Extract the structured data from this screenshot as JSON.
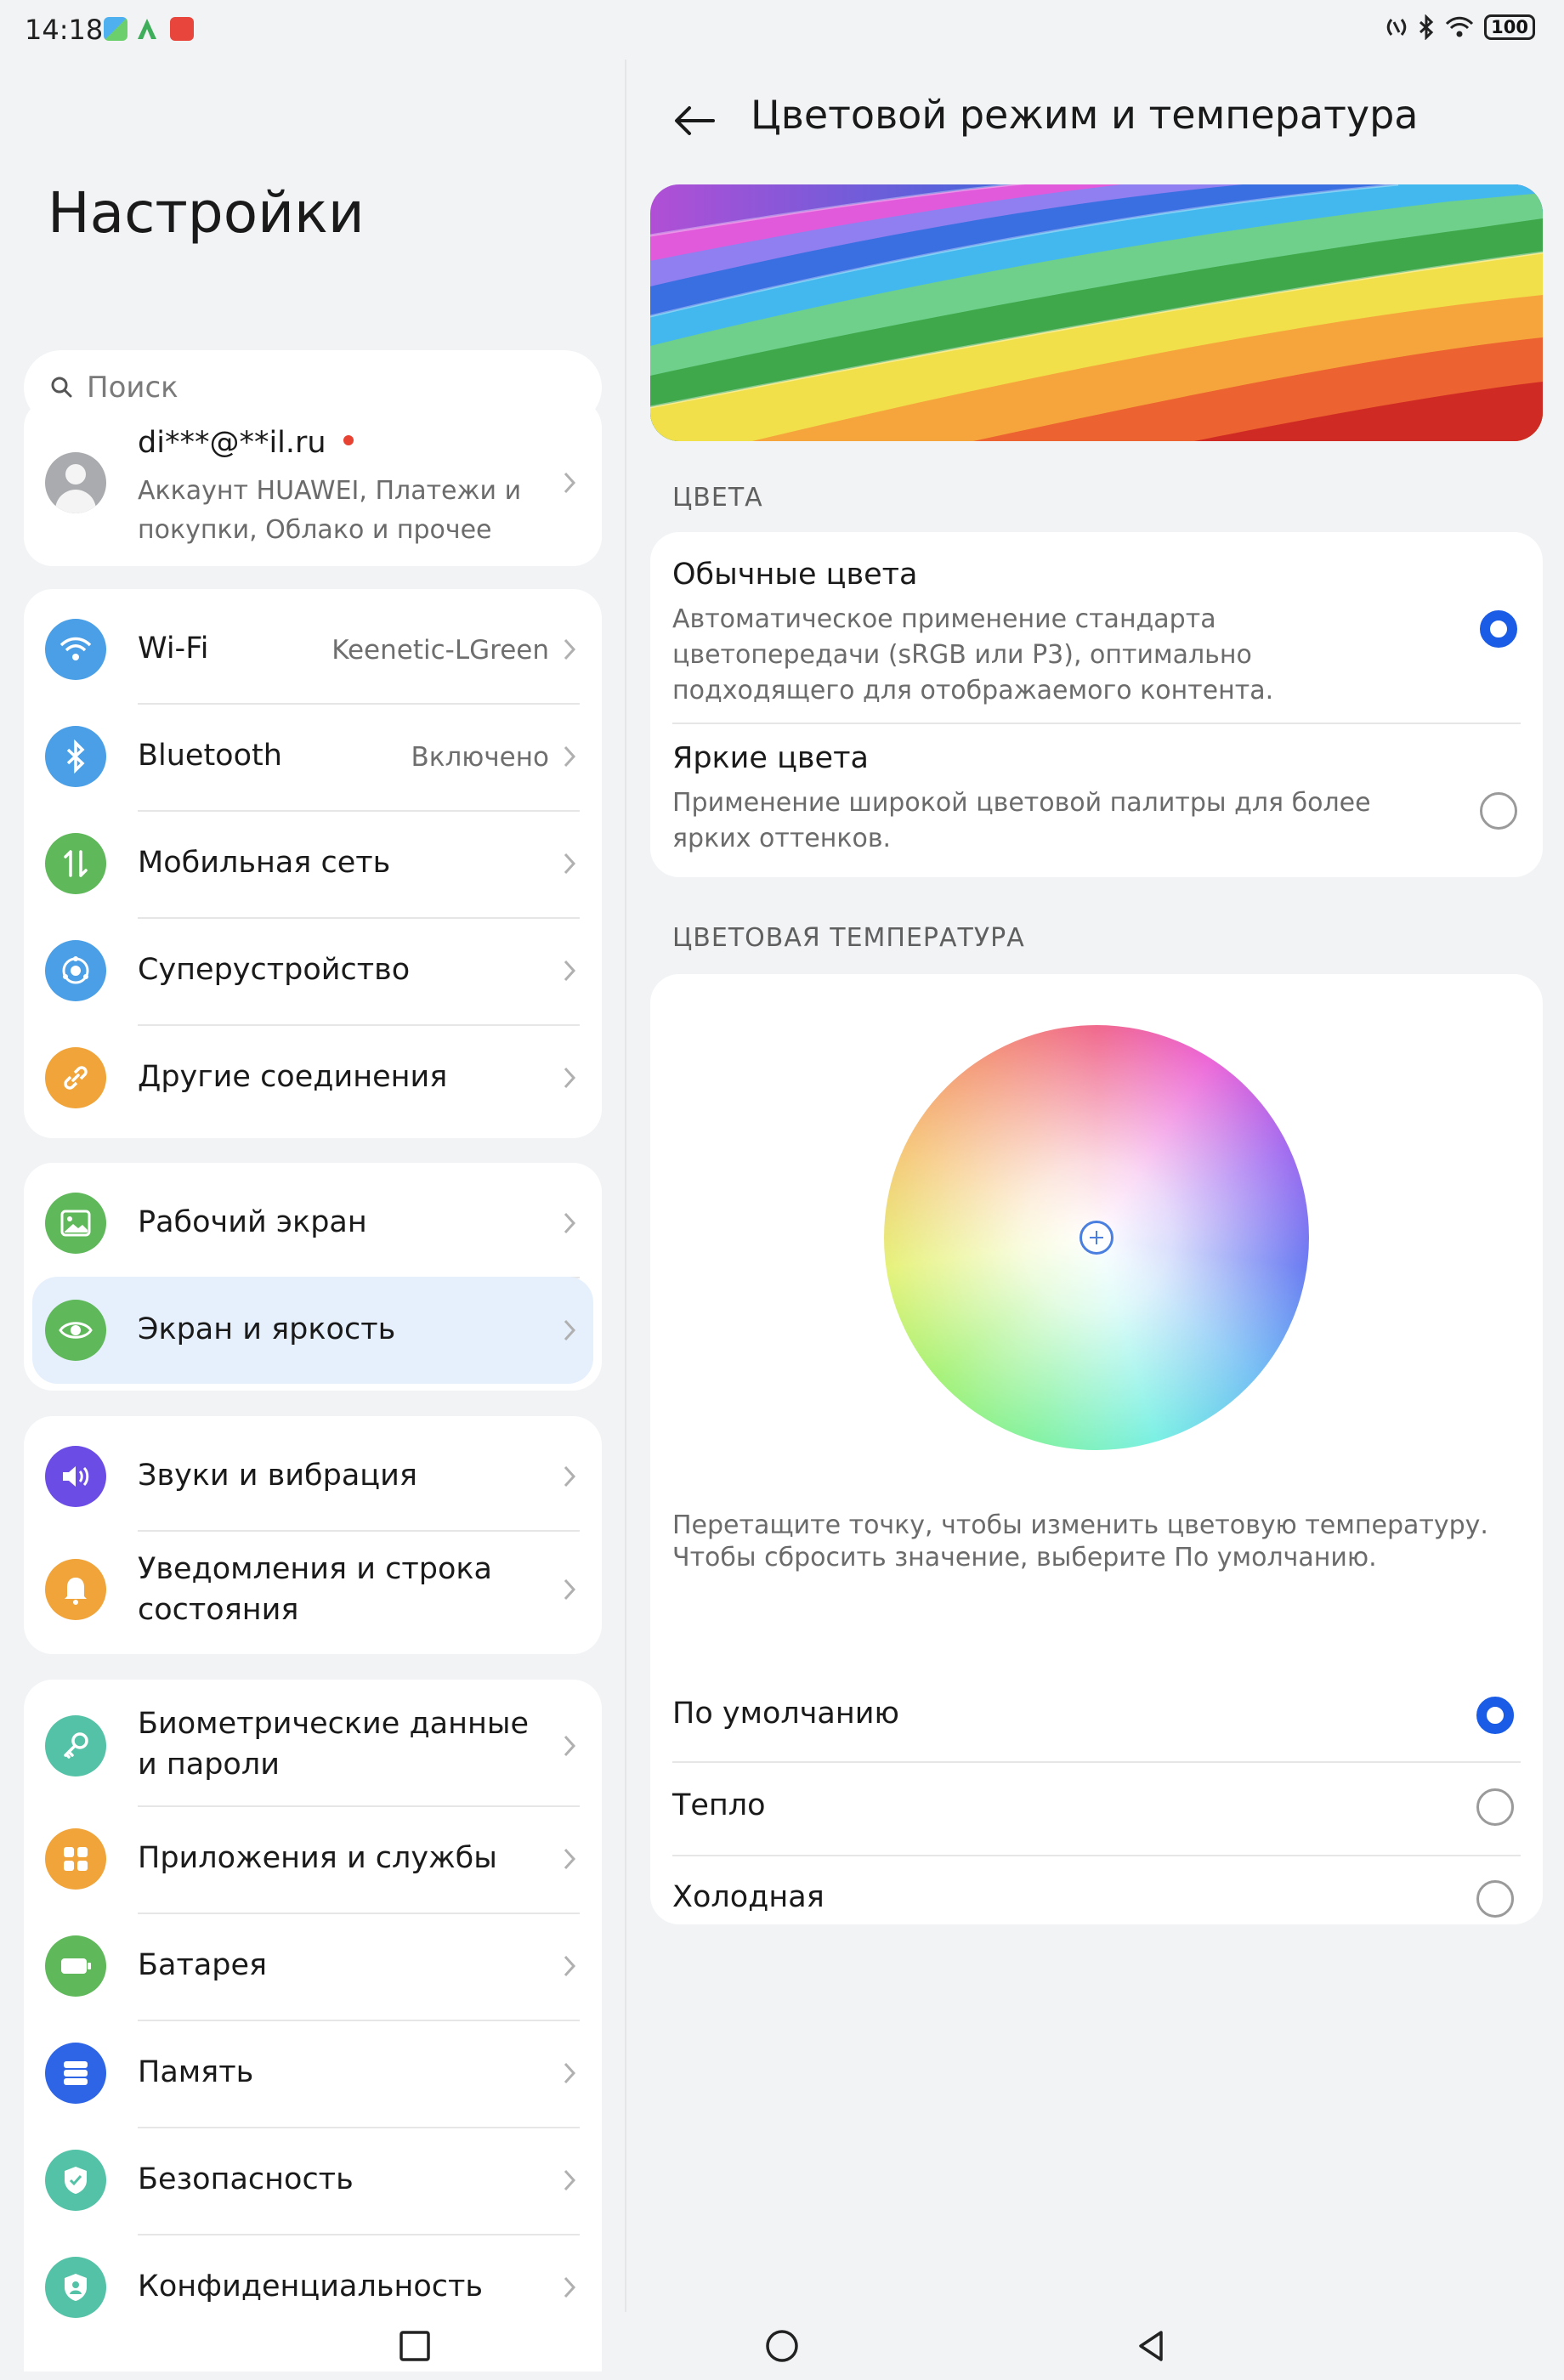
{
  "status_bar": {
    "time": "14:18",
    "battery": "100",
    "notification_icons": [
      "maps-app-icon",
      "android-auto-app-icon",
      "huawei-app-icon"
    ]
  },
  "left": {
    "title": "Настройки",
    "search_placeholder": "Поиск",
    "account": {
      "email": "di***@**il.ru",
      "description": "Аккаунт HUAWEI, Платежи и покупки, Облако и прочее"
    },
    "groups": [
      {
        "items": [
          {
            "label": "Wi-Fi",
            "value": "Keenetic-LGreen",
            "icon": "wifi-icon",
            "color": "#4a9fe6"
          },
          {
            "label": "Bluetooth",
            "value": "Включено",
            "icon": "bluetooth-icon",
            "color": "#4a9fe6"
          },
          {
            "label": "Мобильная сеть",
            "value": "",
            "icon": "mobile-network-icon",
            "color": "#5fb85a"
          },
          {
            "label": "Суперустройство",
            "value": "",
            "icon": "super-device-icon",
            "color": "#4a9fe6"
          },
          {
            "label": "Другие соединения",
            "value": "",
            "icon": "link-icon",
            "color": "#f0a43a"
          }
        ]
      },
      {
        "items": [
          {
            "label": "Рабочий экран",
            "icon": "home-screen-icon",
            "color": "#5fb85a"
          },
          {
            "label": "Экран и яркость",
            "icon": "eye-icon",
            "color": "#5fb85a",
            "selected": true
          }
        ]
      },
      {
        "items": [
          {
            "label": "Звуки и вибрация",
            "icon": "sound-icon",
            "color": "#6b4de6"
          },
          {
            "label": "Уведомления и строка состояния",
            "icon": "bell-icon",
            "color": "#f0a43a"
          }
        ]
      },
      {
        "items": [
          {
            "label": "Биометрические данные и пароли",
            "icon": "key-icon",
            "color": "#53c2a6"
          },
          {
            "label": "Приложения и службы",
            "icon": "apps-icon",
            "color": "#f0a43a"
          },
          {
            "label": "Батарея",
            "icon": "battery-icon",
            "color": "#5fb85a"
          },
          {
            "label": "Память",
            "icon": "storage-icon",
            "color": "#2e64e6"
          },
          {
            "label": "Безопасность",
            "icon": "shield-check-icon",
            "color": "#53c2a6"
          },
          {
            "label": "Конфиденциальность",
            "icon": "privacy-icon",
            "color": "#53c2a6"
          }
        ]
      }
    ]
  },
  "right": {
    "title": "Цветовой режим и температура",
    "colors_caption": "ЦВЕТА",
    "color_options": [
      {
        "title": "Обычные цвета",
        "description": "Автоматическое применение стандарта цветопередачи (sRGB или P3), оптимально подходящего для отображаемого контента.",
        "selected": true
      },
      {
        "title": "Яркие цвета",
        "description": "Применение широкой цветовой палитры для более ярких оттенков.",
        "selected": false
      }
    ],
    "temperature_caption": "ЦВЕТОВАЯ ТЕМПЕРАТУРА",
    "hint": "Перетащите точку, чтобы изменить цветовую температуру. Чтобы сбросить значение, выберите По умолчанию.",
    "temperature_options": [
      {
        "label": "По умолчанию",
        "selected": true
      },
      {
        "label": "Тепло",
        "selected": false
      },
      {
        "label": "Холодная",
        "selected": false
      }
    ]
  },
  "colors": {
    "accent": "#1a5ce6",
    "selected_row_bg": "#e6f0fc",
    "background": "#f1f3f5"
  }
}
